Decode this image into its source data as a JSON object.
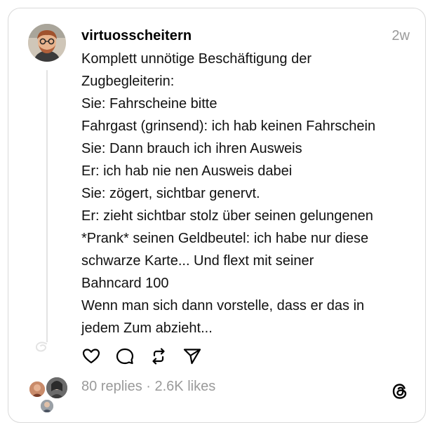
{
  "post": {
    "username": "virtuosscheitern",
    "time": "2w",
    "lines": [
      "Komplett unnötige Beschäftigung der",
      "Zugbegleiterin:",
      "Sie: Fahrscheine bitte",
      "Fahrgast (grinsend): ich hab keinen Fahrschein",
      "Sie: Dann brauch ich ihren Ausweis",
      "Er: ich hab nie nen Ausweis dabei",
      "Sie: zögert, sichtbar genervt.",
      "Er: zieht sichtbar stolz über seinen gelungenen",
      "*Prank* seinen Geldbeutel: ich habe nur diese",
      "schwarze Karte... Und flext mit seiner",
      "Bahncard 100",
      "Wenn man sich dann vorstelle, dass er das in",
      "jedem Zum abzieht..."
    ]
  },
  "actions": {
    "icons": [
      "heart-icon",
      "comment-icon",
      "repost-icon",
      "share-icon"
    ]
  },
  "footer": {
    "stats": "80 replies · 2.6K likes",
    "logo": "threads-logo-icon"
  }
}
